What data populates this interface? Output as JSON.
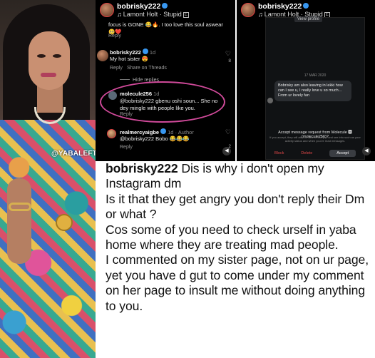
{
  "watermark": "@YABALEFTONLINE",
  "post": {
    "username": "bobrisky222",
    "song": "Lamont Holt · Stupid",
    "explicit_badge": "E"
  },
  "comments": {
    "top_text": "focus is GONE 😂🔥. I too love this soul aswear 🥺❤️",
    "top_reply": "Reply",
    "second": {
      "user": "bobrisky222",
      "time": "1d",
      "text": "My hot sister 😍",
      "reply": "Reply",
      "share": "Share on Threads",
      "likes": "8"
    },
    "hide_replies": "Hide replies",
    "third": {
      "user": "molecule256",
      "time": "1d",
      "mention": "@bobrisky222",
      "text": "gbenu oshi soun... She no dey mingle with people like you.",
      "reply": "Reply"
    },
    "fourth": {
      "user": "realmercyaigbe",
      "time": "1d",
      "author_tag": "Author",
      "mention": "@bobrisky222",
      "text": "Bobo 😂😂😂",
      "reply": "Reply",
      "likes": "2"
    }
  },
  "dm": {
    "top_button": "View profile",
    "date": "17 MAR 2020",
    "message": "Bobrisky am also leaving in lekki how can I see u, I really love u so much... From ur lovely fan",
    "request_title": "Accept message request from Molecule 🅼 (molecule256)?",
    "request_sub": "If you accept, they will also be able to call you and see info such as your activity status and when you've read messages.",
    "block": "Block",
    "delete": "Delete",
    "accept": "Accept"
  },
  "caption": {
    "username": "bobrisky222",
    "line1": "Dis is why i don't open my Instagram dm",
    "line2": "Is it that they get angry you don't reply their Dm or what ?",
    "line3": "Cos some of you need to check urself in yaba home where they are treating mad people.",
    "line4": "I commented on my sister page, not on ur page, yet you have d gut to come under my comment on her page to insult me without doing anything to you."
  },
  "colors": {
    "highlight_ring": "#d04a9a",
    "verified": "#3897f0",
    "block_red": "#e04848"
  }
}
